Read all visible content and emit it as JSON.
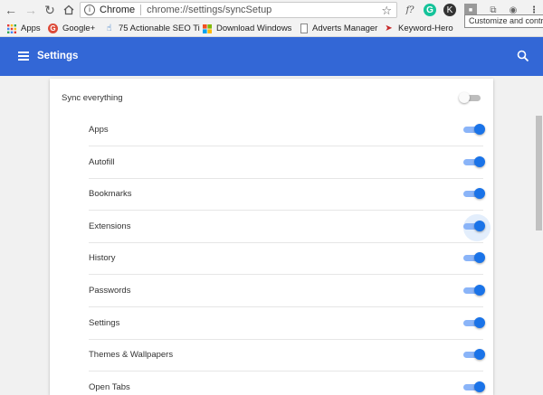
{
  "browser": {
    "site_label": "Chrome",
    "url": "chrome://settings/syncSetup",
    "tooltip": "Customize and control"
  },
  "bookmarks": [
    {
      "label": "Apps",
      "icon": "apps-grid-icon"
    },
    {
      "label": "Google+",
      "icon": "google-plus-icon"
    },
    {
      "label": "75 Actionable SEO Ti",
      "icon": "seo-pointer-icon"
    },
    {
      "label": "Download Windows",
      "icon": "windows-logo-icon"
    },
    {
      "label": "Adverts Manager",
      "icon": "page-icon"
    },
    {
      "label": "Keyword-Hero",
      "icon": "keyword-hero-icon"
    }
  ],
  "header": {
    "title": "Settings"
  },
  "sync": {
    "everything_label": "Sync everything",
    "everything_on": false,
    "items": [
      {
        "label": "Apps",
        "on": true
      },
      {
        "label": "Autofill",
        "on": true
      },
      {
        "label": "Bookmarks",
        "on": true
      },
      {
        "label": "Extensions",
        "on": true
      },
      {
        "label": "History",
        "on": true
      },
      {
        "label": "Passwords",
        "on": true
      },
      {
        "label": "Settings",
        "on": true
      },
      {
        "label": "Themes & Wallpapers",
        "on": true
      },
      {
        "label": "Open Tabs",
        "on": true
      }
    ]
  },
  "colors": {
    "header": "#3367d6",
    "toggle_on": "#1a73e8",
    "toggle_track_on": "#8ab4f8"
  }
}
